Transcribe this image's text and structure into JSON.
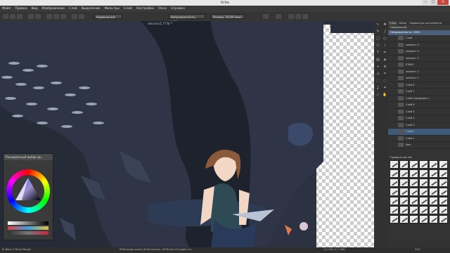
{
  "window": {
    "title": "Krita",
    "min": "–",
    "max": "□",
    "close": "✕"
  },
  "menu": [
    "Файл",
    "Правка",
    "Вид",
    "Изображение",
    "Слой",
    "Выделение",
    "Фильтры",
    "Слой",
    "Настройки",
    "Окно",
    "Справка"
  ],
  "tool_options": {
    "blend_mode": "Нормальный",
    "opacity_label": "Непрозрачность: 100%",
    "size_label": "Размер: 20,00 пикс."
  },
  "document": {
    "tab": "sea.kra (1.7 Гб) *"
  },
  "dock": {
    "tabs": [
      "Слои",
      "Обзор",
      "Параметры инструмента"
    ],
    "blend": "Нормальный",
    "opacity": "Непрозрачность: 100%",
    "layers": [
      "Слой",
      "элемент 5",
      "элемент 4",
      "элемент 3",
      "STAGE",
      "элемент 2",
      "элемент 1",
      "Слой 8",
      "Слой 7",
      "Слой (предварит.)",
      "Слой 6",
      "Слой 5",
      "Слой 4",
      "Слой 3",
      "Слой 2",
      "Слой 1",
      "Фон"
    ],
    "selected_layer_index": 14,
    "presets_title": "Профили кистей"
  },
  "color_selector": {
    "title": "Расширенный выбор цв..."
  },
  "status": {
    "left": "b) Basic-2 Brush Rough",
    "center": "RGB/альфа канал (8-бит/канал), sRGB-elle-V2-srgbtrc.icc",
    "right": "1,5 ГиБ (1,7 ГиБ)",
    "zoom": "33%"
  },
  "colors": {
    "accent": "#3f5a78",
    "canvas": "#2a2f3b",
    "panel": "#333333"
  }
}
